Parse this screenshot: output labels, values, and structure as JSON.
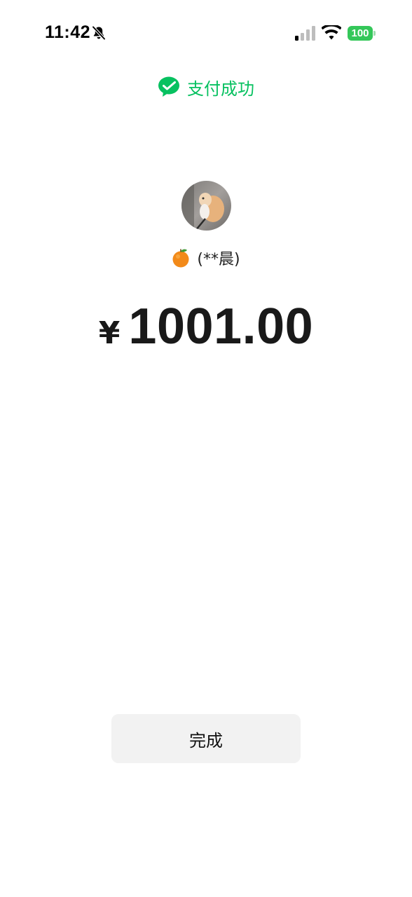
{
  "status_bar": {
    "time": "11:42",
    "battery_level": "100",
    "icons": [
      "bell-slash-icon",
      "cellular-signal-icon",
      "wifi-icon",
      "battery-icon"
    ]
  },
  "header": {
    "icon": "wechat-pay-icon",
    "title": "支付成功",
    "accent_color": "#07c160"
  },
  "payee": {
    "avatar": "avatar-cat-photo",
    "emoji_icon": "orange-fruit-icon",
    "name": "(**晨)"
  },
  "payment": {
    "currency_symbol": "¥",
    "amount": "1001.00"
  },
  "actions": {
    "done_label": "完成"
  }
}
